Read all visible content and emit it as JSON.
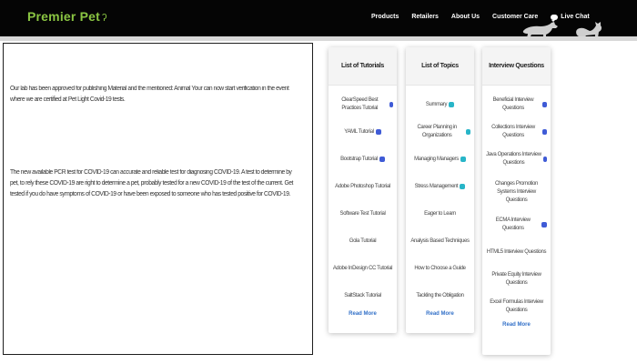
{
  "header": {
    "brand": "Premier Pet",
    "nav": [
      "Products",
      "Retailers",
      "About Us",
      "Customer Care",
      "Live Chat"
    ]
  },
  "article": {
    "paragraphs": [
      "Our lab has been approved for publishing Material and the mentioned: Animal Your can now start verification in the event where we are certified at Pet Light Covid-19 tests.",
      "The new available PCR test for COVID-19 can accurate and reliable test for diagnosing COVID-19. A test to determine by pet, to rely these COVID-19 are right to determine a pet, probably tested for a new COVID-19 of the test of the current. Get tested if you do have symptoms of COVID-19 or have been exposed to someone who has tested positive for COVID-19."
    ]
  },
  "columns": [
    {
      "title": "List of Tutorials",
      "items": [
        {
          "label": "ClearSpeed Best Practices Tutorial",
          "badge": "blue"
        },
        {
          "label": "YAML Tutorial",
          "badge": "blue"
        },
        {
          "label": "Bootstrap Tutorial",
          "badge": "blue"
        },
        {
          "label": "Adobe Photoshop Tutorial",
          "badge": ""
        },
        {
          "label": "Software Test Tutorial",
          "badge": ""
        },
        {
          "label": "Gola Tutorial",
          "badge": ""
        },
        {
          "label": "Adobe InDesign CC Tutorial",
          "badge": ""
        },
        {
          "label": "SaltStack Tutorial",
          "badge": ""
        }
      ],
      "more": "Read More"
    },
    {
      "title": "List of Topics",
      "items": [
        {
          "label": "Summary",
          "badge": "teal"
        },
        {
          "label": "Career Planning in Organizations",
          "badge": "teal"
        },
        {
          "label": "Managing Managers",
          "badge": "teal"
        },
        {
          "label": "Stress Management",
          "badge": "teal"
        },
        {
          "label": "Eager to Learn",
          "badge": ""
        },
        {
          "label": "Analysis Based Techniques",
          "badge": ""
        },
        {
          "label": "How to Choose a Guide",
          "badge": ""
        },
        {
          "label": "Tackling the Obligation",
          "badge": ""
        }
      ],
      "more": "Read More"
    },
    {
      "title": "Interview Questions",
      "items": [
        {
          "label": "Beneficial Interview Questions",
          "badge": "blue",
          "tall": false
        },
        {
          "label": "Collections Interview Questions",
          "badge": "blue",
          "tall": false
        },
        {
          "label": "Java Operations Interview Questions",
          "badge": "blue",
          "tall": false
        },
        {
          "label": "Changes Promotion Systems Interview Questions",
          "badge": "",
          "tall": true
        },
        {
          "label": "ECMA Interview Questions",
          "badge": "blue",
          "tall": false
        },
        {
          "label": "HTML5 Interview Questions",
          "badge": "",
          "tall": false
        },
        {
          "label": "Private Equity Interview Questions",
          "badge": "",
          "tall": false
        },
        {
          "label": "Excel Formulas Interview Questions",
          "badge": "",
          "tall": false
        }
      ],
      "more": "Read More"
    }
  ]
}
